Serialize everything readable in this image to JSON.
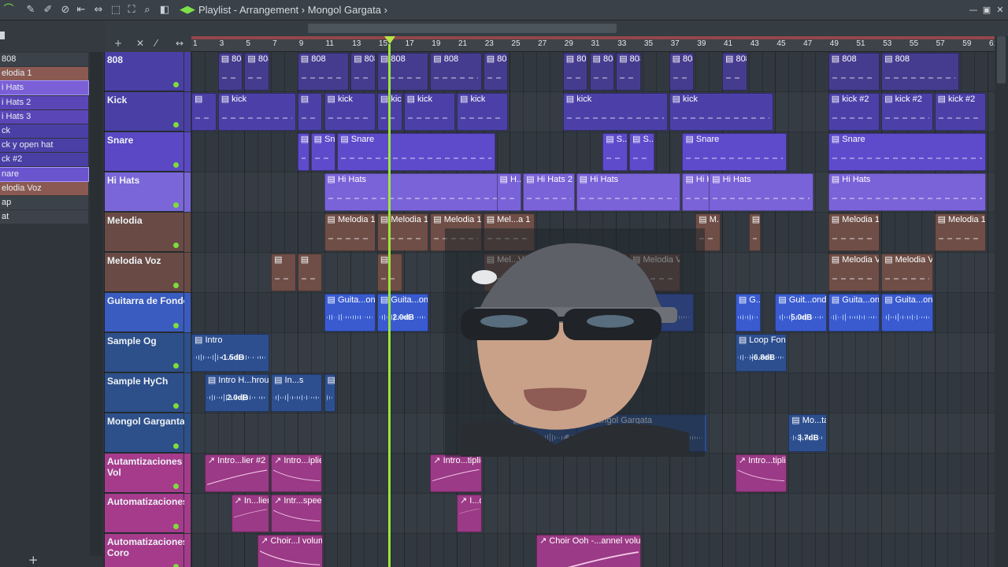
{
  "titlebar": {
    "title": "Playlist - Arrangement",
    "separator": "›",
    "pattern": "Mongol Gargata",
    "icons": [
      "magnet-icon",
      "pencil-icon",
      "brush-icon",
      "mute-icon",
      "slip-icon",
      "slice-icon",
      "select-icon",
      "zoom-icon",
      "speaker-icon"
    ],
    "window_controls": [
      "minimize-icon",
      "maximize-icon",
      "close-icon"
    ]
  },
  "browser": {
    "items": [
      {
        "label": "808",
        "color": "#3c4249",
        "selected": false
      },
      {
        "label": "elodia 1",
        "color": "#8a5a52",
        "selected": false
      },
      {
        "label": "i Hats",
        "color": "#7a5fd6",
        "selected": true
      },
      {
        "label": "i Hats 2",
        "color": "#5b46b8",
        "selected": false
      },
      {
        "label": "i Hats 3",
        "color": "#5b46b8",
        "selected": false
      },
      {
        "label": "ck",
        "color": "#4a3fa5",
        "selected": false
      },
      {
        "label": "ck y open hat",
        "color": "#4a3fa5",
        "selected": false
      },
      {
        "label": "ck #2",
        "color": "#4a3fa5",
        "selected": false
      },
      {
        "label": "nare",
        "color": "#6a55cf",
        "selected": true
      },
      {
        "label": "elodia Voz",
        "color": "#8a5a52",
        "selected": false
      },
      {
        "label": "ap",
        "color": "#3c4249",
        "selected": false
      },
      {
        "label": "at",
        "color": "#3c4249",
        "selected": false
      }
    ],
    "add_label": "+"
  },
  "ruler": {
    "numbers": [
      "1",
      "3",
      "5",
      "7",
      "9",
      "11",
      "13",
      "15",
      "17",
      "19",
      "21",
      "23",
      "25",
      "27",
      "29",
      "31",
      "33",
      "35",
      "37",
      "39",
      "41",
      "43",
      "45",
      "47",
      "49",
      "51",
      "53",
      "55",
      "57",
      "59",
      "61"
    ]
  },
  "tracks": [
    {
      "name": "808",
      "color": "#4a3fa5"
    },
    {
      "name": "Kick",
      "color": "#4a3fa5"
    },
    {
      "name": "Snare",
      "color": "#5a48c4"
    },
    {
      "name": "Hi Hats",
      "color": "#7a66d8"
    },
    {
      "name": "Melodia",
      "color": "#6a4a44"
    },
    {
      "name": "Melodia Voz",
      "color": "#6a4a44"
    },
    {
      "name": "Guitarra de Fondo",
      "color": "#3a5bc0"
    },
    {
      "name": "Sample Og",
      "color": "#2d4f8a"
    },
    {
      "name": "Sample HyCh",
      "color": "#2d4f8a"
    },
    {
      "name": "Mongol Garganta",
      "color": "#2d4f8a"
    },
    {
      "name": "Autamtizaciones Vol",
      "color": "#a63b8c"
    },
    {
      "name": "Automatizaciones",
      "color": "#a63b8c"
    },
    {
      "name": "Automatizaciones Coro",
      "color": "#a63b8c"
    }
  ],
  "clip_colors": {
    "808": "#463c8f",
    "kick": "#4c40a8",
    "snare": "#5e4bcc",
    "hihat": "#7a63d8",
    "melodia": "#6e4e47",
    "guitar": "#3a5bd0",
    "sample": "#2e4f8f",
    "auto": "#9b3a86"
  },
  "clips": [
    {
      "track": 0,
      "label": "808",
      "kind": "808"
    },
    {
      "track": 0,
      "label": "808",
      "kind": "808"
    },
    {
      "track": 0,
      "label": "808",
      "kind": "808"
    },
    {
      "track": 0,
      "label": "808",
      "kind": "808"
    },
    {
      "track": 0,
      "label": "808",
      "kind": "808"
    },
    {
      "track": 0,
      "label": "808",
      "kind": "808"
    },
    {
      "track": 0,
      "label": "808",
      "kind": "808"
    },
    {
      "track": 0,
      "label": "808",
      "kind": "808"
    },
    {
      "track": 0,
      "label": "808",
      "kind": "808"
    },
    {
      "track": 0,
      "label": "808",
      "kind": "808"
    },
    {
      "track": 0,
      "label": "808",
      "kind": "808"
    },
    {
      "track": 0,
      "label": "808",
      "kind": "808"
    },
    {
      "track": 0,
      "label": "808",
      "kind": "808"
    },
    {
      "track": 0,
      "label": "808",
      "kind": "808"
    },
    {
      "track": 1,
      "label": "",
      "kind": "kick"
    },
    {
      "track": 1,
      "label": "kick",
      "kind": "kick"
    },
    {
      "track": 1,
      "label": "",
      "kind": "kick"
    },
    {
      "track": 1,
      "label": "kick",
      "kind": "kick"
    },
    {
      "track": 1,
      "label": "kick",
      "kind": "kick"
    },
    {
      "track": 1,
      "label": "kick",
      "kind": "kick"
    },
    {
      "track": 1,
      "label": "kick",
      "kind": "kick"
    },
    {
      "track": 1,
      "label": "kick",
      "kind": "kick"
    },
    {
      "track": 1,
      "label": "kick",
      "kind": "kick"
    },
    {
      "track": 1,
      "label": "kick #2",
      "kind": "kick"
    },
    {
      "track": 1,
      "label": "kick #2",
      "kind": "kick"
    },
    {
      "track": 1,
      "label": "kick #2",
      "kind": "kick"
    },
    {
      "track": 2,
      "label": "",
      "kind": "snare"
    },
    {
      "track": 2,
      "label": "Snare",
      "kind": "snare"
    },
    {
      "track": 2,
      "label": "Snare",
      "kind": "snare"
    },
    {
      "track": 2,
      "label": "S...e",
      "kind": "snare"
    },
    {
      "track": 2,
      "label": "S...e",
      "kind": "snare"
    },
    {
      "track": 2,
      "label": "Snare",
      "kind": "snare"
    },
    {
      "track": 2,
      "label": "Snare",
      "kind": "snare"
    },
    {
      "track": 3,
      "label": "Hi Hats",
      "kind": "hihat"
    },
    {
      "track": 3,
      "label": "H...s",
      "kind": "hihat"
    },
    {
      "track": 3,
      "label": "Hi Hats 2",
      "kind": "hihat"
    },
    {
      "track": 3,
      "label": "Hi Hats",
      "kind": "hihat"
    },
    {
      "track": 3,
      "label": "Hi Hats",
      "kind": "hihat"
    },
    {
      "track": 3,
      "label": "Hi Hats",
      "kind": "hihat"
    },
    {
      "track": 3,
      "label": "Hi Hats",
      "kind": "hihat"
    },
    {
      "track": 4,
      "label": "Melodia 1",
      "kind": "melodia"
    },
    {
      "track": 4,
      "label": "Melodia 1",
      "kind": "melodia"
    },
    {
      "track": 4,
      "label": "Melodia 1",
      "kind": "melodia"
    },
    {
      "track": 4,
      "label": "Mel...a 1",
      "kind": "melodia"
    },
    {
      "track": 4,
      "label": "M...1",
      "kind": "melodia"
    },
    {
      "track": 4,
      "label": "",
      "kind": "melodia"
    },
    {
      "track": 4,
      "label": "Melodia 1",
      "kind": "melodia"
    },
    {
      "track": 4,
      "label": "Melodia 1",
      "kind": "melodia"
    },
    {
      "track": 5,
      "label": "",
      "kind": "melodia"
    },
    {
      "track": 5,
      "label": "",
      "kind": "melodia"
    },
    {
      "track": 5,
      "label": "",
      "kind": "melodia"
    },
    {
      "track": 5,
      "label": "Mel...Voz",
      "kind": "melodia"
    },
    {
      "track": 5,
      "label": "Melodia Voz",
      "kind": "melodia"
    },
    {
      "track": 5,
      "label": "Melodia Voz",
      "kind": "melodia"
    },
    {
      "track": 5,
      "label": "Melodia Voz",
      "kind": "melodia"
    },
    {
      "track": 5,
      "label": "Melodia Voz",
      "kind": "melodia"
    },
    {
      "track": 6,
      "label": "Guita...ondo",
      "kind": "guitar",
      "vol": ""
    },
    {
      "track": 6,
      "label": "Guita...ondo",
      "kind": "guitar",
      "vol": "2.0dB"
    },
    {
      "track": 6,
      "label": "Guita...ondo",
      "kind": "guitar",
      "vol": "4.0dB"
    },
    {
      "track": 6,
      "label": "Guitarra de Fondo",
      "kind": "guitar",
      "vol": "3.0dB"
    },
    {
      "track": 6,
      "label": "G...o",
      "kind": "guitar",
      "vol": ""
    },
    {
      "track": 6,
      "label": "Guit...ondo",
      "kind": "guitar",
      "vol": "5.0dB"
    },
    {
      "track": 6,
      "label": "Guita...ondo",
      "kind": "guitar",
      "vol": ""
    },
    {
      "track": 6,
      "label": "Guita...ondo",
      "kind": "guitar",
      "vol": ""
    },
    {
      "track": 7,
      "label": "Intro",
      "kind": "sample",
      "vol": "-1.5dB"
    },
    {
      "track": 7,
      "label": "Loop Fondo",
      "kind": "sample",
      "vol": "-6.8dB"
    },
    {
      "track": 8,
      "label": "Intro H...hrous",
      "kind": "sample",
      "vol": "2.0dB"
    },
    {
      "track": 8,
      "label": "In...s",
      "kind": "sample",
      "vol": ""
    },
    {
      "track": 8,
      "label": "",
      "kind": "sample",
      "vol": ""
    },
    {
      "track": 9,
      "label": "Mongol...rgata",
      "kind": "sample",
      "vol": "6.0dB"
    },
    {
      "track": 9,
      "label": "Mongol Gargata",
      "kind": "sample",
      "vol": "2.5dB"
    },
    {
      "track": 9,
      "label": "Mo...ta",
      "kind": "sample",
      "vol": "3.7dB"
    },
    {
      "track": 10,
      "label": "Intro...lier #2",
      "kind": "auto"
    },
    {
      "track": 10,
      "label": "Intro...iplier",
      "kind": "auto"
    },
    {
      "track": 10,
      "label": "Intro...tiplier",
      "kind": "auto"
    },
    {
      "track": 10,
      "label": "Intro...tiplier",
      "kind": "auto"
    },
    {
      "track": 11,
      "label": "In...lier",
      "kind": "auto"
    },
    {
      "track": 11,
      "label": "Intr...speed",
      "kind": "auto"
    },
    {
      "track": 11,
      "label": "I...d",
      "kind": "auto"
    },
    {
      "track": 12,
      "label": "Choir...l volume",
      "kind": "auto"
    },
    {
      "track": 12,
      "label": "Choir Ooh -...annel volume",
      "kind": "auto"
    }
  ]
}
